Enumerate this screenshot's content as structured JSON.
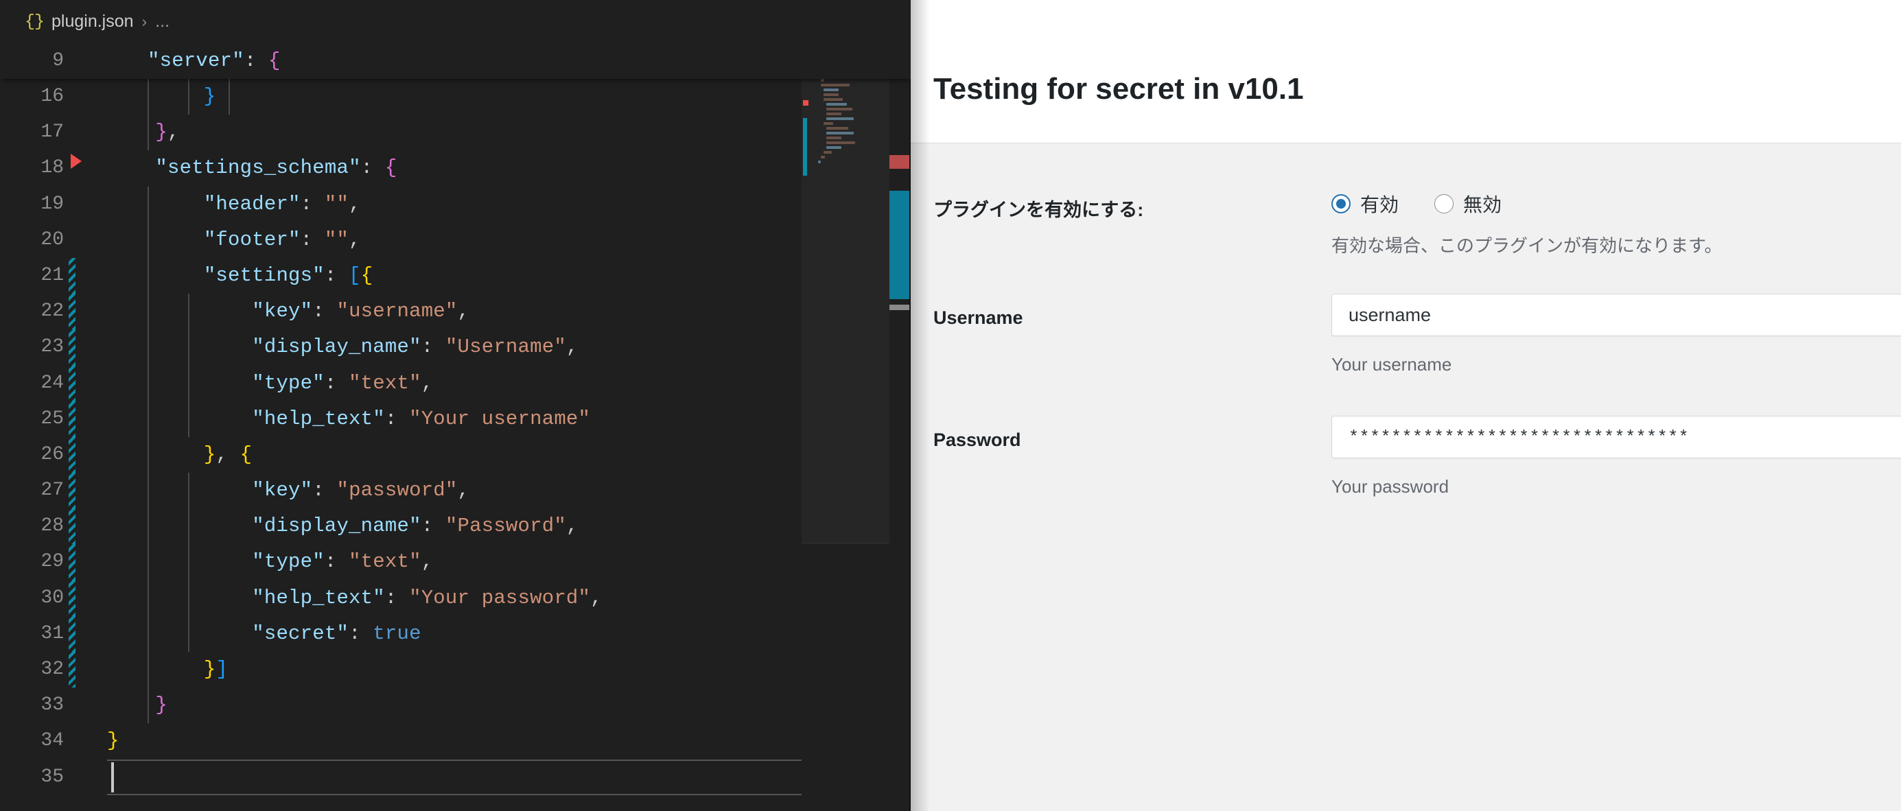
{
  "editor": {
    "breadcrumb": {
      "icon": "json-braces-icon",
      "braces": "{}",
      "file": "plugin.json",
      "separator": "›",
      "dots": "..."
    },
    "sticky_line": {
      "number": "9",
      "text": "\"server\": {"
    },
    "lines": [
      {
        "number": "16",
        "tokens": [
          {
            "t": "        ",
            "c": "p"
          },
          {
            "t": "}",
            "c": "br2"
          }
        ]
      },
      {
        "number": "17",
        "tokens": [
          {
            "t": "    ",
            "c": "p"
          },
          {
            "t": "}",
            "c": "br1"
          },
          {
            "t": ",",
            "c": "p"
          }
        ]
      },
      {
        "number": "18",
        "tokens": [
          {
            "t": "    ",
            "c": "p"
          },
          {
            "t": "\"settings_schema\"",
            "c": "k"
          },
          {
            "t": ": ",
            "c": "p"
          },
          {
            "t": "{",
            "c": "br1"
          }
        ]
      },
      {
        "number": "19",
        "tokens": [
          {
            "t": "        ",
            "c": "p"
          },
          {
            "t": "\"header\"",
            "c": "k"
          },
          {
            "t": ": ",
            "c": "p"
          },
          {
            "t": "\"\"",
            "c": "s"
          },
          {
            "t": ",",
            "c": "p"
          }
        ]
      },
      {
        "number": "20",
        "tokens": [
          {
            "t": "        ",
            "c": "p"
          },
          {
            "t": "\"footer\"",
            "c": "k"
          },
          {
            "t": ": ",
            "c": "p"
          },
          {
            "t": "\"\"",
            "c": "s"
          },
          {
            "t": ",",
            "c": "p"
          }
        ]
      },
      {
        "number": "21",
        "tokens": [
          {
            "t": "        ",
            "c": "p"
          },
          {
            "t": "\"settings\"",
            "c": "k"
          },
          {
            "t": ": ",
            "c": "p"
          },
          {
            "t": "[",
            "c": "br2"
          },
          {
            "t": "{",
            "c": "br3"
          }
        ]
      },
      {
        "number": "22",
        "tokens": [
          {
            "t": "            ",
            "c": "p"
          },
          {
            "t": "\"key\"",
            "c": "k"
          },
          {
            "t": ": ",
            "c": "p"
          },
          {
            "t": "\"username\"",
            "c": "s"
          },
          {
            "t": ",",
            "c": "p"
          }
        ]
      },
      {
        "number": "23",
        "tokens": [
          {
            "t": "            ",
            "c": "p"
          },
          {
            "t": "\"display_name\"",
            "c": "k"
          },
          {
            "t": ": ",
            "c": "p"
          },
          {
            "t": "\"Username\"",
            "c": "s"
          },
          {
            "t": ",",
            "c": "p"
          }
        ]
      },
      {
        "number": "24",
        "tokens": [
          {
            "t": "            ",
            "c": "p"
          },
          {
            "t": "\"type\"",
            "c": "k"
          },
          {
            "t": ": ",
            "c": "p"
          },
          {
            "t": "\"text\"",
            "c": "s"
          },
          {
            "t": ",",
            "c": "p"
          }
        ]
      },
      {
        "number": "25",
        "tokens": [
          {
            "t": "            ",
            "c": "p"
          },
          {
            "t": "\"help_text\"",
            "c": "k"
          },
          {
            "t": ": ",
            "c": "p"
          },
          {
            "t": "\"Your username\"",
            "c": "s"
          }
        ]
      },
      {
        "number": "26",
        "tokens": [
          {
            "t": "        ",
            "c": "p"
          },
          {
            "t": "}",
            "c": "br3"
          },
          {
            "t": ", ",
            "c": "p"
          },
          {
            "t": "{",
            "c": "br3"
          }
        ]
      },
      {
        "number": "27",
        "tokens": [
          {
            "t": "            ",
            "c": "p"
          },
          {
            "t": "\"key\"",
            "c": "k"
          },
          {
            "t": ": ",
            "c": "p"
          },
          {
            "t": "\"password\"",
            "c": "s"
          },
          {
            "t": ",",
            "c": "p"
          }
        ]
      },
      {
        "number": "28",
        "tokens": [
          {
            "t": "            ",
            "c": "p"
          },
          {
            "t": "\"display_name\"",
            "c": "k"
          },
          {
            "t": ": ",
            "c": "p"
          },
          {
            "t": "\"Password\"",
            "c": "s"
          },
          {
            "t": ",",
            "c": "p"
          }
        ]
      },
      {
        "number": "29",
        "tokens": [
          {
            "t": "            ",
            "c": "p"
          },
          {
            "t": "\"type\"",
            "c": "k"
          },
          {
            "t": ": ",
            "c": "p"
          },
          {
            "t": "\"text\"",
            "c": "s"
          },
          {
            "t": ",",
            "c": "p"
          }
        ]
      },
      {
        "number": "30",
        "tokens": [
          {
            "t": "            ",
            "c": "p"
          },
          {
            "t": "\"help_text\"",
            "c": "k"
          },
          {
            "t": ": ",
            "c": "p"
          },
          {
            "t": "\"Your password\"",
            "c": "s"
          },
          {
            "t": ",",
            "c": "p"
          }
        ]
      },
      {
        "number": "31",
        "tokens": [
          {
            "t": "            ",
            "c": "p"
          },
          {
            "t": "\"secret\"",
            "c": "k"
          },
          {
            "t": ": ",
            "c": "p"
          },
          {
            "t": "true",
            "c": "b"
          }
        ]
      },
      {
        "number": "32",
        "tokens": [
          {
            "t": "        ",
            "c": "p"
          },
          {
            "t": "}",
            "c": "br3"
          },
          {
            "t": "]",
            "c": "br2"
          }
        ]
      },
      {
        "number": "33",
        "tokens": [
          {
            "t": "    ",
            "c": "p"
          },
          {
            "t": "}",
            "c": "br1"
          }
        ]
      },
      {
        "number": "34",
        "tokens": [
          {
            "t": "}",
            "c": "br3"
          }
        ]
      },
      {
        "number": "35",
        "tokens": []
      }
    ],
    "colors": {
      "background": "#1f1f1f",
      "key": "#9cdcfe",
      "string": "#ce9178",
      "boolean": "#569cd6",
      "bracket_pink": "#da70d6",
      "bracket_blue": "#179fff",
      "bracket_yellow": "#ffd700",
      "git_change": "#0c8ea8",
      "error": "#f14c4c"
    }
  },
  "panel": {
    "title": "Testing for secret in v10.1",
    "fields": [
      {
        "label": "プラグインを有効にする:",
        "type": "radio",
        "options": [
          {
            "label": "有効",
            "checked": true
          },
          {
            "label": "無効",
            "checked": false
          }
        ],
        "help": "有効な場合、このプラグインが有効になります。"
      },
      {
        "label": "Username",
        "type": "text",
        "value": "username",
        "help": "Your username"
      },
      {
        "label": "Password",
        "type": "text",
        "value": "********************************",
        "help": "Your password"
      }
    ],
    "colors": {
      "header_bg": "#ffffff",
      "body_bg": "#f1f1f1",
      "accent": "#2271b1",
      "text": "#1d2327",
      "help_text": "#646970"
    }
  }
}
